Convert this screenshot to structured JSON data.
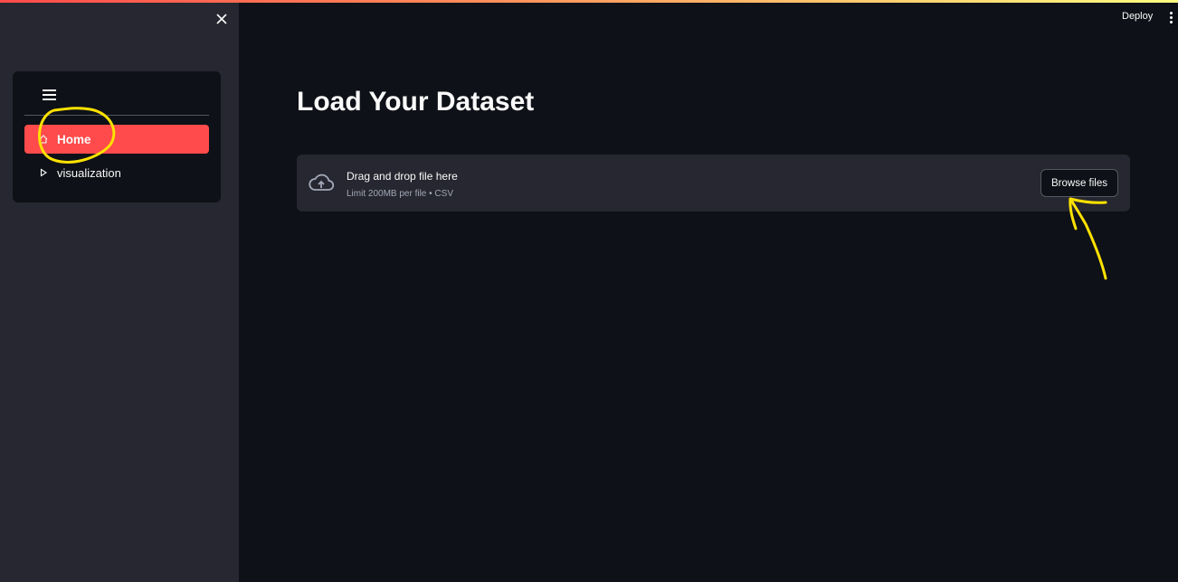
{
  "header": {
    "deploy_label": "Deploy",
    "menu_icon": "kebab-menu-icon"
  },
  "sidebar": {
    "close_icon": "close-icon",
    "menu_icon": "hamburger-icon",
    "items": [
      {
        "label": "Home",
        "icon": "home-icon",
        "active": true
      },
      {
        "label": "visualization",
        "icon": "play-triangle-icon",
        "active": false
      }
    ]
  },
  "main": {
    "title": "Load Your Dataset",
    "uploader": {
      "icon": "cloud-upload-icon",
      "title": "Drag and drop file here",
      "limit": "Limit 200MB per file • CSV",
      "button_label": "Browse files"
    }
  },
  "colors": {
    "accent": "#ff4b4b",
    "background": "#0e1117",
    "sidebar": "#262730",
    "annotation": "#ffe100"
  }
}
